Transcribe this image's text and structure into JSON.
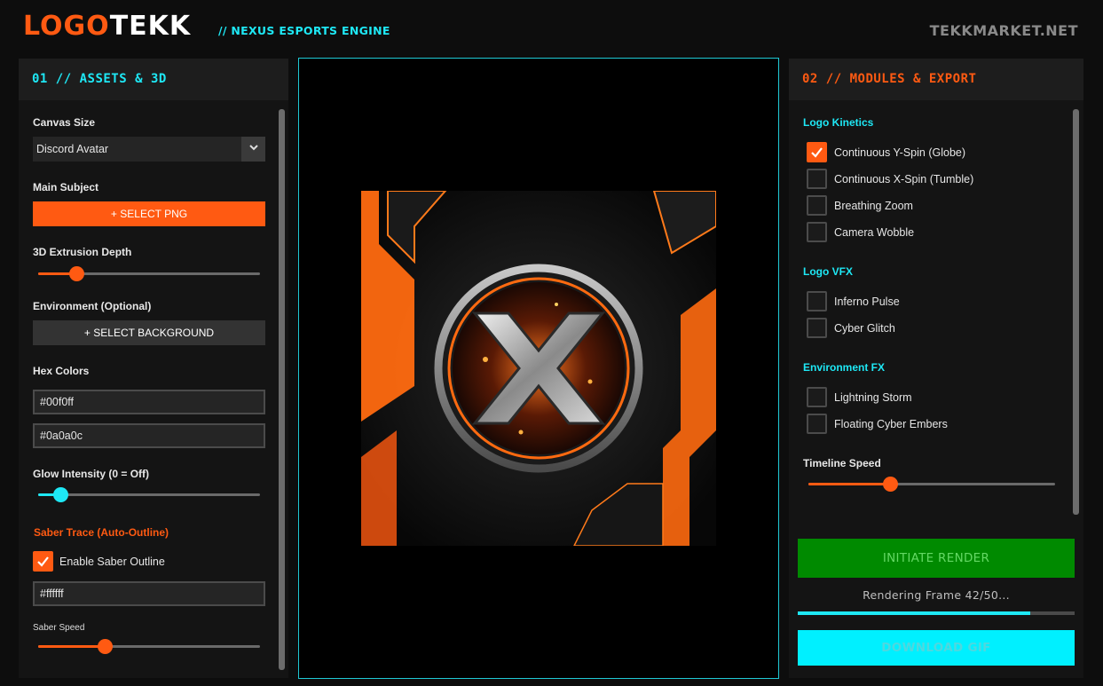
{
  "header": {
    "logo_part1": "LOGO",
    "logo_part2": "TEKK",
    "tagline": "// NEXUS ESPORTS ENGINE",
    "site": "TEKKMARKET.NET"
  },
  "left_panel": {
    "title_num": "01",
    "title_sep": "//",
    "title_text": "ASSETS & 3D",
    "canvas_size_label": "Canvas Size",
    "canvas_size_value": "Discord Avatar",
    "main_subject_label": "Main Subject",
    "select_png_label": "+ SELECT PNG",
    "extrusion_label": "3D Extrusion Depth",
    "extrusion_value": 0.17,
    "environment_label": "Environment (Optional)",
    "select_bg_label": "+ SELECT BACKGROUND",
    "hex_colors_label": "Hex Colors",
    "hex_color_1": "#00f0ff",
    "hex_color_2": "#0a0a0c",
    "glow_label": "Glow Intensity (0 = Off)",
    "glow_value": 0.1,
    "saber_label": "Saber Trace (Auto-Outline)",
    "saber_enable_label": "Enable Saber Outline",
    "saber_enabled": true,
    "saber_color": "#ffffff",
    "saber_speed_label": "Saber Speed",
    "saber_speed_value": 0.3
  },
  "right_panel": {
    "title_num": "02",
    "title_sep": "//",
    "title_text": "MODULES & EXPORT",
    "kinetics_label": "Logo Kinetics",
    "kinetics": [
      {
        "label": "Continuous Y-Spin (Globe)",
        "checked": true
      },
      {
        "label": "Continuous X-Spin (Tumble)",
        "checked": false
      },
      {
        "label": "Breathing Zoom",
        "checked": false
      },
      {
        "label": "Camera Wobble",
        "checked": false
      }
    ],
    "vfx_label": "Logo VFX",
    "vfx": [
      {
        "label": "Inferno Pulse",
        "checked": false
      },
      {
        "label": "Cyber Glitch",
        "checked": false
      }
    ],
    "env_fx_label": "Environment FX",
    "env_fx": [
      {
        "label": "Lightning Storm",
        "checked": false
      },
      {
        "label": "Floating Cyber Embers",
        "checked": false
      }
    ],
    "timeline_label": "Timeline Speed",
    "timeline_value": 0.33,
    "render_label": "INITIATE RENDER",
    "render_status": "Rendering Frame 42/50...",
    "render_progress": 0.84,
    "download_label": "DOWNLOAD GIF"
  },
  "colors": {
    "accent_orange": "#ff5a12",
    "accent_cyan": "#1ee8f5",
    "render_green": "#008a00"
  }
}
